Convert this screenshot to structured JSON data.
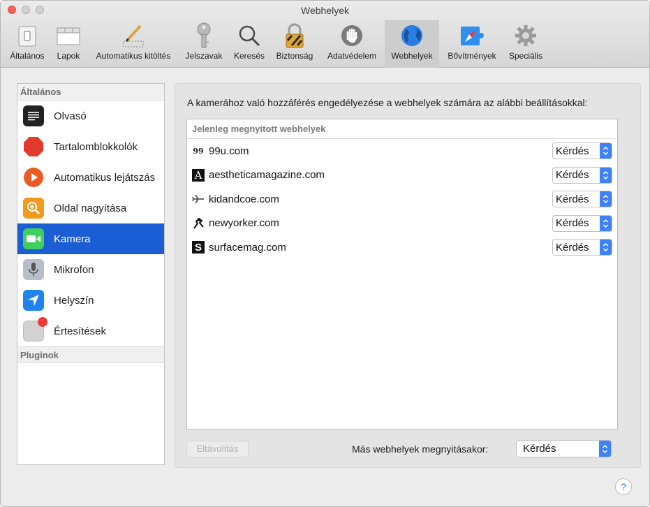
{
  "window": {
    "title": "Webhelyek"
  },
  "toolbar": {
    "tabs": [
      {
        "label": "Általános",
        "icon": "switch-icon"
      },
      {
        "label": "Lapok",
        "icon": "tabs-icon"
      },
      {
        "label": "Automatikus kitöltés",
        "icon": "pencil-icon"
      },
      {
        "label": "Jelszavak",
        "icon": "key-icon"
      },
      {
        "label": "Keresés",
        "icon": "magnifier-icon"
      },
      {
        "label": "Biztonság",
        "icon": "padlock-icon"
      },
      {
        "label": "Adatvédelem",
        "icon": "hand-icon"
      },
      {
        "label": "Webhelyek",
        "icon": "globe-icon",
        "selected": true
      },
      {
        "label": "Bővítmények",
        "icon": "extension-icon"
      },
      {
        "label": "Speciális",
        "icon": "gears-icon"
      }
    ]
  },
  "sidebar": {
    "general_header": "Általános",
    "plugins_header": "Pluginok",
    "items": [
      {
        "label": "Olvasó",
        "icon": "reader-icon"
      },
      {
        "label": "Tartalomblokkolók",
        "icon": "stop-sign-icon"
      },
      {
        "label": "Automatikus lejátszás",
        "icon": "play-icon"
      },
      {
        "label": "Oldal nagyítása",
        "icon": "zoom-icon"
      },
      {
        "label": "Kamera",
        "icon": "camera-icon",
        "selected": true
      },
      {
        "label": "Mikrofon",
        "icon": "microphone-icon"
      },
      {
        "label": "Helyszín",
        "icon": "location-arrow-icon"
      },
      {
        "label": "Értesítések",
        "icon": "notification-icon"
      }
    ]
  },
  "main": {
    "description": "A kamerához való hozzáférés engedélyezése a webhelyek számára az alábbi beállításokkal:",
    "table_header": "Jelenleg megnyitott webhelyek",
    "sites": [
      {
        "name": "99u.com",
        "favicon_text": "99",
        "setting": "Kérdés"
      },
      {
        "name": "aestheticamagazine.com",
        "favicon_text": "A",
        "setting": "Kérdés"
      },
      {
        "name": "kidandcoe.com",
        "favicon_text": "",
        "setting": "Kérdés"
      },
      {
        "name": "newyorker.com",
        "favicon_text": "",
        "setting": "Kérdés"
      },
      {
        "name": "surfacemag.com",
        "favicon_text": "S",
        "setting": "Kérdés"
      }
    ],
    "remove_button": "Eltávolítás",
    "other_sites_label": "Más webhelyek megnyitásakor:",
    "other_sites_value": "Kérdés"
  },
  "help": {
    "label": "?"
  },
  "colors": {
    "accent": "#3f82f7",
    "selection": "#1a5dd4",
    "close": "#fc5f57"
  }
}
